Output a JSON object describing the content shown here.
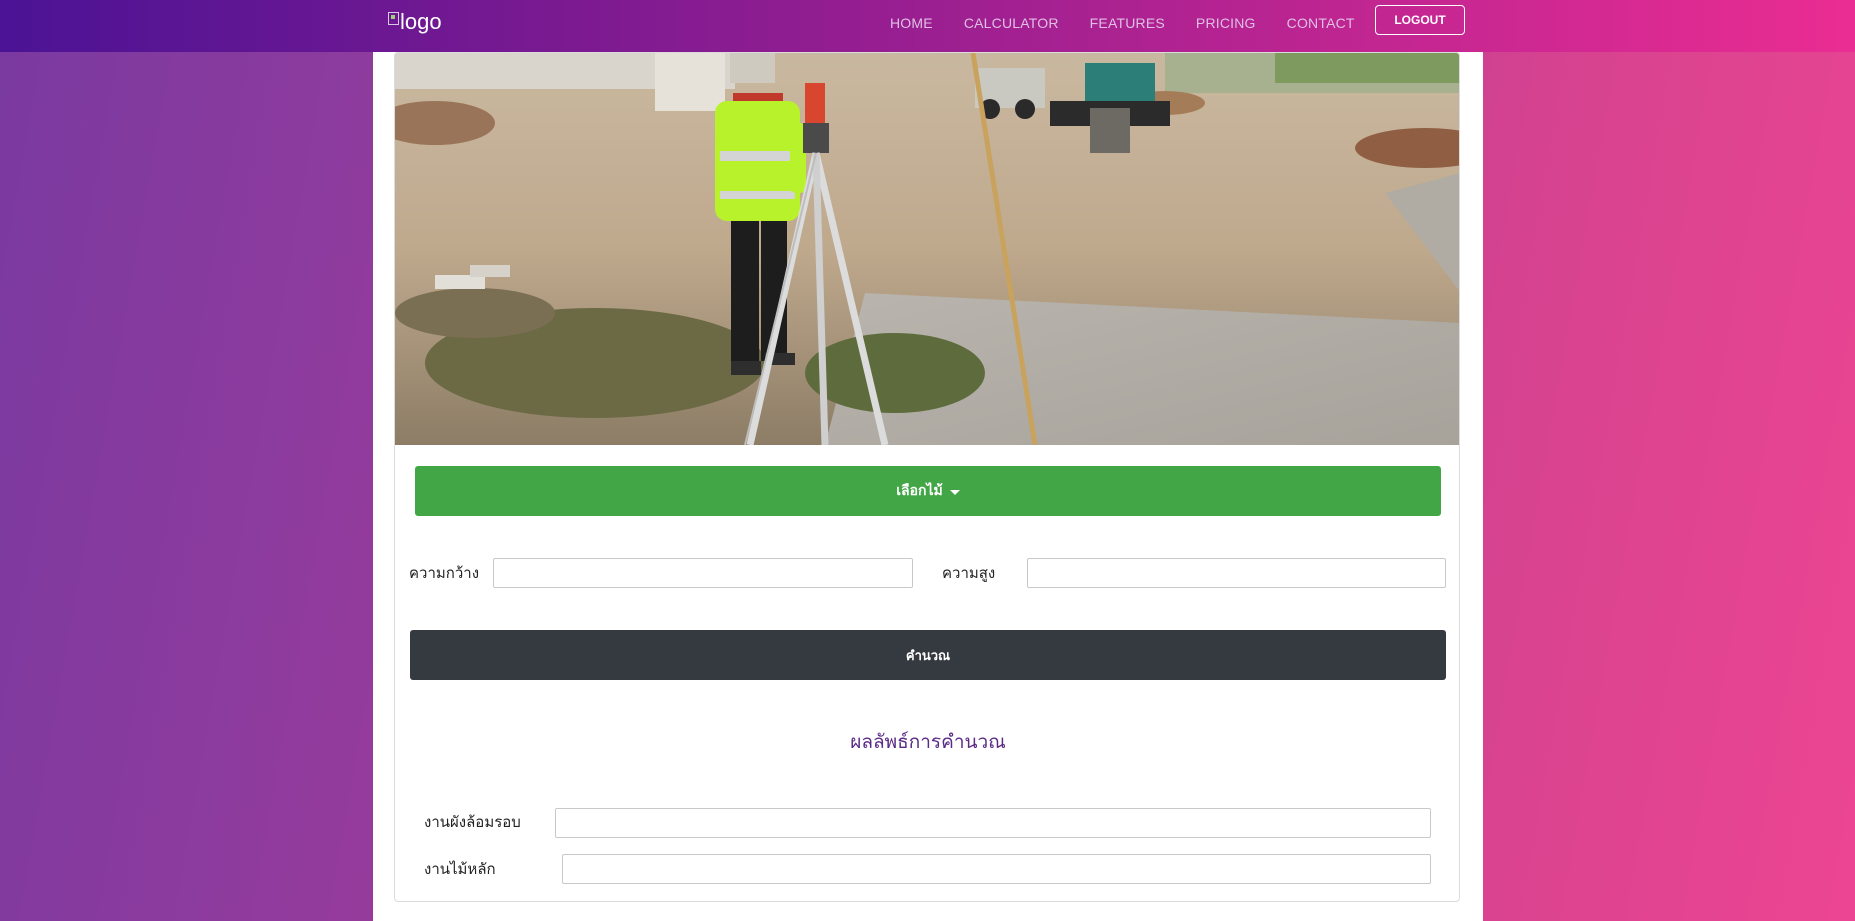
{
  "navbar": {
    "logo_alt": "logo",
    "links": [
      "HOME",
      "CALCULATOR",
      "FEATURES",
      "PRICING",
      "CONTACT"
    ],
    "logout_label": "LOGOUT"
  },
  "form": {
    "select_wood_label": "เลือกไม้",
    "width_label": "ความกว้าง",
    "height_label": "ความสูง",
    "width_value": "",
    "height_value": "",
    "calculate_label": "คำนวณ"
  },
  "results": {
    "title": "ผลลัพธ์การคำนวณ",
    "perimeter_label": "งานผังล้อมรอบ",
    "post_label": "งานไม้หลัก",
    "perimeter_value": "",
    "post_value": ""
  },
  "colors": {
    "select_button": "#43a646",
    "calculate_button": "#343a40",
    "result_title": "#5b2a86"
  }
}
